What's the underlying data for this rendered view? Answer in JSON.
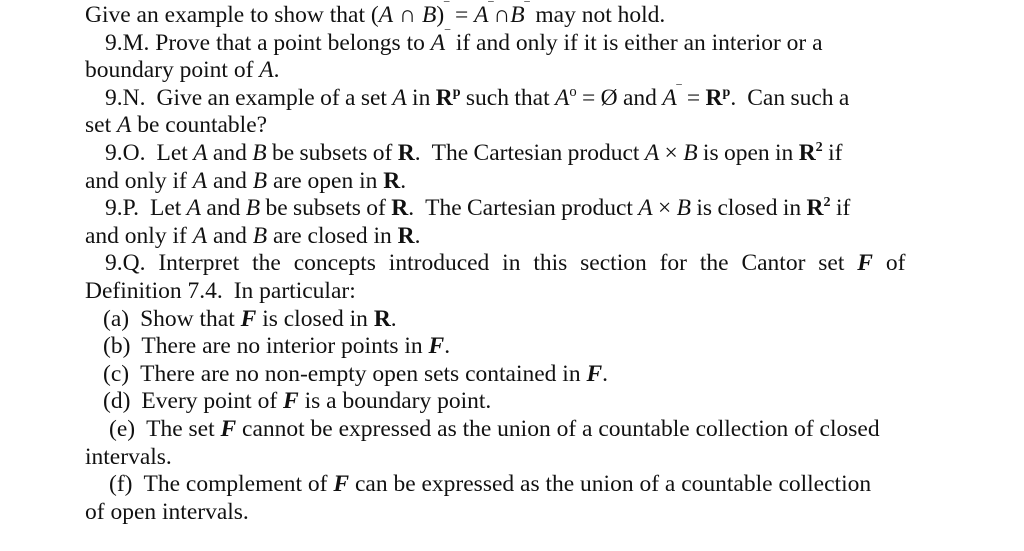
{
  "document": {
    "type": "scanned-textbook-page",
    "background_color": "#ffffff",
    "text_color": "#111111",
    "subject": "real analysis exercises"
  },
  "lines": [
    {
      "id": "l1",
      "text": "Give an example to show that (A ∩ B)⁻ = A⁻ ∩ B⁻ may not hold."
    },
    {
      "id": "l2",
      "text": "9.M. Prove that a point belongs to A⁻ if and only if it is either an interior or a"
    },
    {
      "id": "l3",
      "text": "boundary point of A."
    },
    {
      "id": "l4",
      "text": "9.N.  Give an example of a set A in Rᵖ such that A⁰ = Ø and A⁻ = Rᵖ.  Can such a"
    },
    {
      "id": "l5",
      "text": "set A be countable?"
    },
    {
      "id": "l6",
      "text": "9.O.  Let A and B be subsets of R.   The Cartesian product A × B is open in R² if"
    },
    {
      "id": "l7",
      "text": "and only if A and B are open in R."
    },
    {
      "id": "l8",
      "text": "9.P.  Let A and B be subsets of R.   The Cartesian product A × B is closed in R² if"
    },
    {
      "id": "l9",
      "text": "and only if A and B are closed in R."
    },
    {
      "id": "l10",
      "text": "9.Q. Interpret the concepts introduced in this section for the Cantor set F of"
    },
    {
      "id": "l11",
      "text": "Definition 7.4.   In particular:"
    },
    {
      "id": "l12",
      "text": "(a)  Show that F is closed in R."
    },
    {
      "id": "l13",
      "text": "(b)  There are no interior points in F."
    },
    {
      "id": "l14",
      "text": "(c)  There are no non-empty open sets contained in F."
    },
    {
      "id": "l15",
      "text": "(d)  Every point of F is a boundary point."
    },
    {
      "id": "l16",
      "text": "(e)  The set F cannot be expressed as the union of a countable collection of closed"
    },
    {
      "id": "l17",
      "text": "intervals."
    },
    {
      "id": "l18",
      "text": "(f)  The complement of F can be expressed as the union of a countable collection"
    },
    {
      "id": "l19",
      "text": "of open intervals."
    }
  ],
  "exercises": [
    {
      "label": "9.M.",
      "body": "Prove that a point belongs to A⁻ if and only if it is either an interior or a boundary point of A."
    },
    {
      "label": "9.N.",
      "body": "Give an example of a set A in Rᵖ such that A⁰ = Ø and A⁻ = Rᵖ.  Can such a set A be countable?"
    },
    {
      "label": "9.O.",
      "body": "Let A and B be subsets of R.  The Cartesian product A × B is open in R² if and only if A and B are open in R."
    },
    {
      "label": "9.P.",
      "body": "Let A and B be subsets of R.  The Cartesian product A × B is closed in R² if and only if A and B are closed in R."
    },
    {
      "label": "9.Q.",
      "body": "Interpret the concepts introduced in this section for the Cantor set F of Definition 7.4.  In particular:",
      "subitems": [
        {
          "label": "(a)",
          "text": "Show that F is closed in R."
        },
        {
          "label": "(b)",
          "text": "There are no interior points in F."
        },
        {
          "label": "(c)",
          "text": "There are no non-empty open sets contained in F."
        },
        {
          "label": "(d)",
          "text": "Every point of F is a boundary point."
        },
        {
          "label": "(e)",
          "text": "The set F cannot be expressed as the union of a countable collection of closed intervals."
        },
        {
          "label": "(f)",
          "text": "The complement of F can be expressed as the union of a countable collection of open intervals."
        }
      ]
    }
  ],
  "fragments": {
    "give_example_lead": "Give an example to show that",
    "may_not_hold": "may not hold.",
    "label_9m": "9.M.",
    "m_prove": "Prove that a point belongs to",
    "m_iff": "if and only if it is either an interior or a",
    "m_cont": "boundary point of",
    "period": ".",
    "label_9n": "9.N.",
    "n_give": "Give an example of a set",
    "n_in": "in",
    "n_such_that": "such that",
    "n_and": "and",
    "n_cansuch": "Can such a",
    "n_cont": "set",
    "n_countable": "be countable?",
    "label_9o": "9.O.",
    "o_let": "Let",
    "and_word": "and",
    "o_subsets": "be subsets of",
    "o_cartesian": "The Cartesian product",
    "o_isopen": "is open in",
    "if_word": "if",
    "o_cont_andonly": "and only if",
    "o_cont_areopen": "are open in",
    "label_9p": "9.P.",
    "p_isclosed": "is closed in",
    "p_cont_areclosed": "are closed in",
    "label_9q": "9.Q.",
    "q_interpret": "Interpret the concepts introduced in this section for the Cantor set",
    "of_word": "of",
    "q_definition": "Definition 7.4.",
    "q_inparticular": "In particular:",
    "label_a": "(a)",
    "a_text_pre": "Show that",
    "a_text_mid": "is closed in",
    "label_b": "(b)",
    "b_text_pre": "There are no interior points in",
    "label_c": "(c)",
    "c_text_pre": "There are no non-empty open sets contained in",
    "label_d": "(d)",
    "d_text_pre": "Every point of",
    "d_text_post": "is a boundary point.",
    "label_e": "(e)",
    "e_text_pre": "The set",
    "e_text_post": "cannot be expressed as the union of a countable collection of closed",
    "e_cont": "intervals.",
    "label_f": "(f)",
    "f_text_pre": "The complement of",
    "f_text_post": "can be expressed as the union of a countable collection",
    "f_cont": "of open intervals.",
    "sym_A": "A",
    "sym_B": "B",
    "sym_R": "R",
    "sym_F": "F",
    "sym_bar": "‾",
    "sym_intersect": "∩",
    "sym_times": "×",
    "sym_equals": "=",
    "sym_emptyset": "Ø",
    "sym_lparen": "(",
    "sym_rparen": ")",
    "sup_p": "p",
    "sup_2": "2",
    "sup_0": "o"
  }
}
